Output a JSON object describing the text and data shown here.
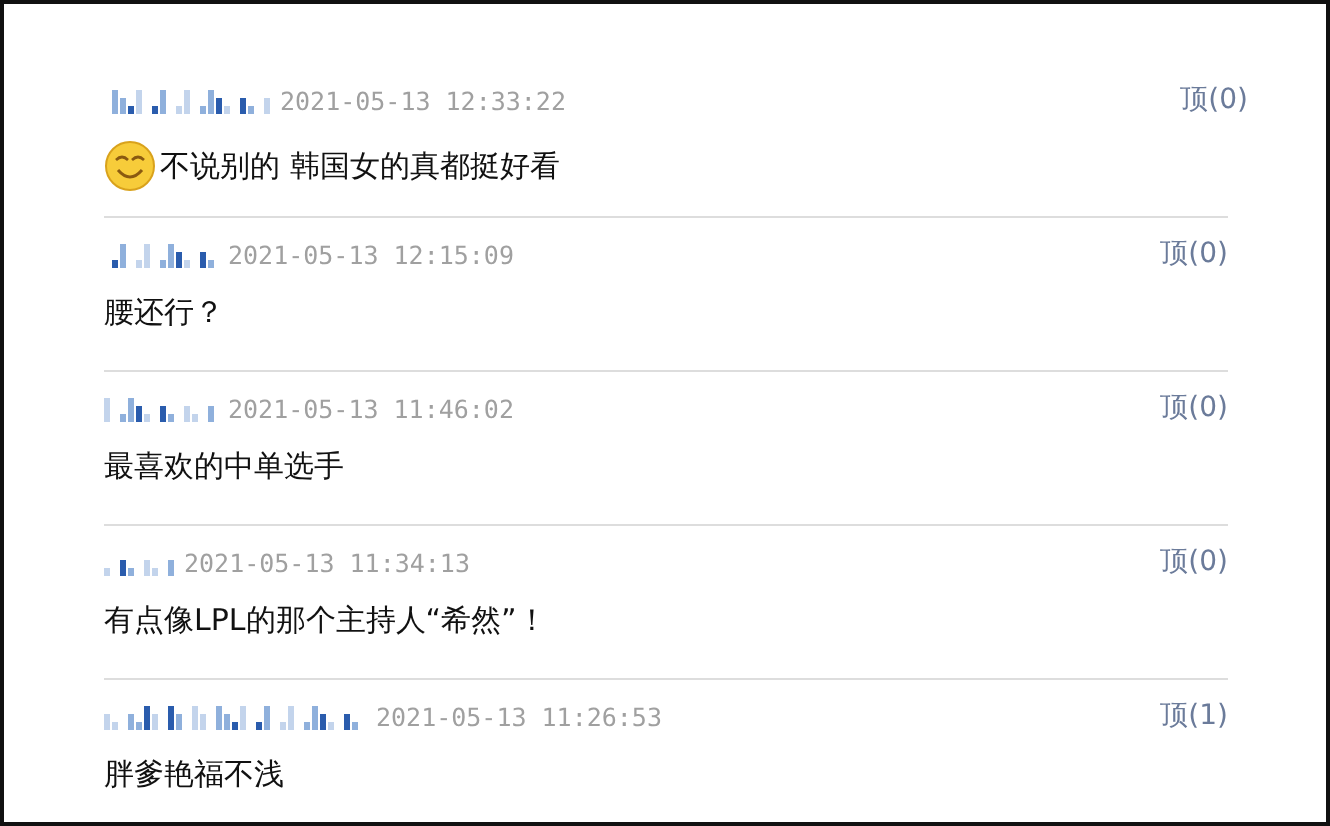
{
  "comments": [
    {
      "time": "2021-05-13 12:33:22",
      "vote": "顶(0)",
      "text": "不说别的 韩国女的真都挺好看",
      "emoticon": true
    },
    {
      "time": "2021-05-13 12:15:09",
      "vote": "顶(0)",
      "text": "腰还行？",
      "emoticon": false
    },
    {
      "time": "2021-05-13 11:46:02",
      "vote": "顶(0)",
      "text": "最喜欢的中单选手",
      "emoticon": false
    },
    {
      "time": "2021-05-13 11:34:13",
      "vote": "顶(0)",
      "text": "有点像LPL的那个主持人“希然”！",
      "emoticon": false
    },
    {
      "time": "2021-05-13 11:26:53",
      "vote": "顶(1)",
      "text": "胖爹艳福不浅",
      "emoticon": false
    }
  ]
}
